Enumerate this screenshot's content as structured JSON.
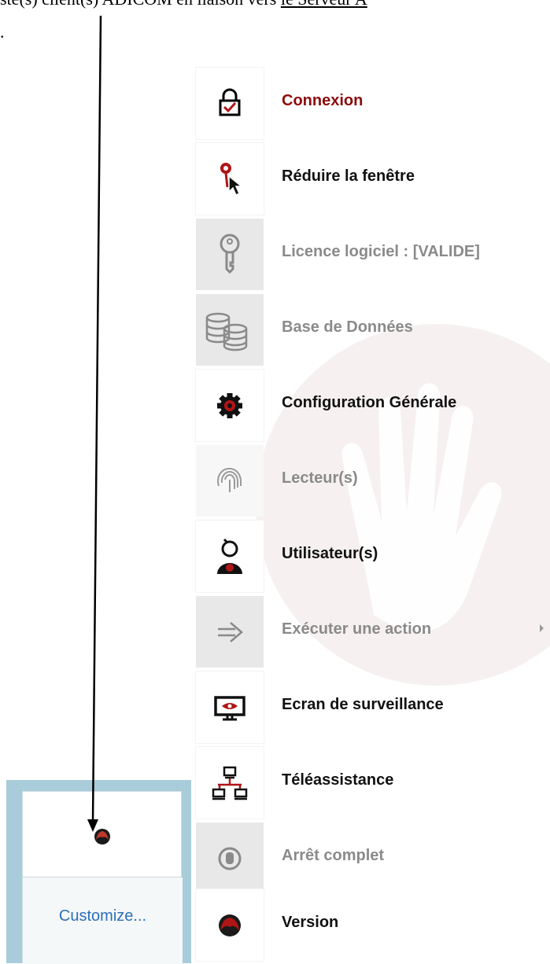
{
  "document": {
    "text_before": "ste(s) client(s) ADICOM en liaison vers ",
    "text_underlined": "le Serveur A",
    "line2": "."
  },
  "menu": {
    "accent_color": "#8b0d0d",
    "items": [
      {
        "label": "Connexion",
        "icon": "lock-check-icon",
        "enabled": true,
        "accent": true
      },
      {
        "label": "Réduire la fenêtre",
        "icon": "cursor-pin-icon",
        "enabled": true
      },
      {
        "label": "Licence logiciel : [VALIDE]",
        "icon": "key-icon",
        "enabled": false
      },
      {
        "label": "Base de Données",
        "icon": "database-icon",
        "enabled": false
      },
      {
        "label": "Configuration Générale",
        "icon": "gear-icon",
        "enabled": true
      },
      {
        "label": "Lecteur(s)",
        "icon": "fingerprint-icon",
        "enabled": false
      },
      {
        "label": "Utilisateur(s)",
        "icon": "user-icon",
        "enabled": true
      },
      {
        "label": "Exécuter une action",
        "icon": "arrow-right-icon",
        "enabled": false,
        "submenu": true
      },
      {
        "label": "Ecran de surveillance",
        "icon": "monitor-eye-icon",
        "enabled": true
      },
      {
        "label": "Téléassistance",
        "icon": "network-icon",
        "enabled": true
      },
      {
        "label": "Arrêt complet",
        "icon": "stop-icon",
        "enabled": false
      },
      {
        "label": "Version",
        "icon": "app-logo-icon",
        "enabled": true
      }
    ]
  },
  "tray": {
    "customize_label": "Customize...",
    "icon": "app-logo-icon"
  }
}
